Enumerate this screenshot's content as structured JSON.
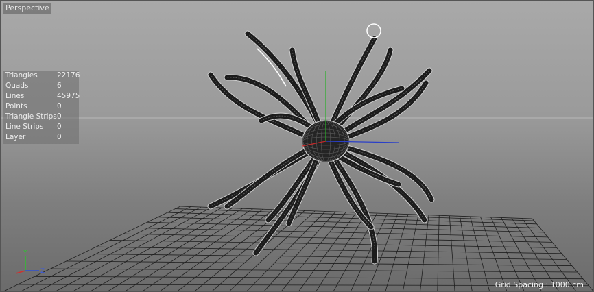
{
  "viewport": {
    "camera_label": "Perspective",
    "grid_spacing_label": "Grid Spacing : 1000 cm"
  },
  "stats": [
    {
      "label": "Triangles",
      "value": "22176"
    },
    {
      "label": "Quads",
      "value": "6"
    },
    {
      "label": "Lines",
      "value": "45975"
    },
    {
      "label": "Points",
      "value": "0"
    },
    {
      "label": "Triangle Strips",
      "value": "0"
    },
    {
      "label": "Line Strips",
      "value": "0"
    },
    {
      "label": "Layer",
      "value": "0"
    }
  ],
  "axis_gizmo": {
    "y_label": "Y",
    "z_label": "Z"
  },
  "colors": {
    "axis_x": "#d03030",
    "axis_y": "#30c030",
    "axis_z": "#3050d0",
    "mesh": "#1c1c1c"
  }
}
